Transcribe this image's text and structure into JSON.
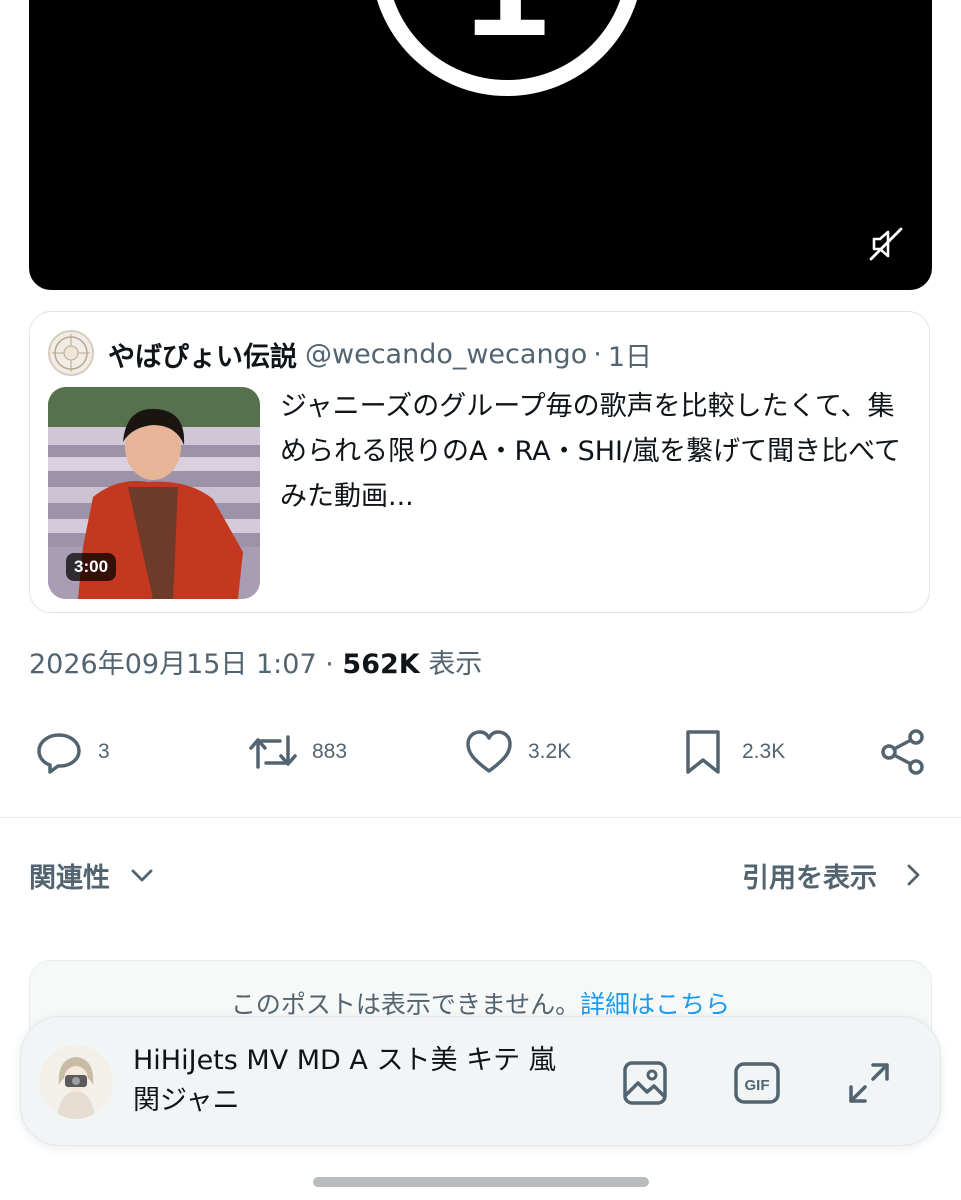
{
  "video": {
    "countdown_number": "1",
    "mute_icon": "speaker-muted-icon"
  },
  "quote": {
    "name": "やばぴょい伝説",
    "handle": "@wecando_wecango",
    "separator": "·",
    "time": "1日",
    "text": "ジャニーズのグループ毎の歌声を比較したくて、集められる限りのA・RA・SHI/嵐を繋げて聞き比べてみた動画...",
    "video_duration": "3:00"
  },
  "meta": {
    "timestamp": "2026年09月15日 1:07",
    "separator": "·",
    "views_count": "562K",
    "views_label": "表示"
  },
  "actions": {
    "replies": "3",
    "reposts": "883",
    "likes": "3.2K",
    "bookmarks": "2.3K"
  },
  "sort": {
    "label": "関連性"
  },
  "view_quotes": {
    "label": "引用を表示"
  },
  "unavailable": {
    "message": "このポストは表示できません。",
    "link": "詳細はこちら"
  },
  "composer": {
    "text": "HiHiJets MV MD A スト美 キテ 嵐 関ジャニ",
    "icons": [
      "image-icon",
      "gif-icon",
      "expand-icon"
    ]
  },
  "colors": {
    "text_primary": "#0f1419",
    "text_secondary": "#536471",
    "link": "#1d9bf0",
    "border": "#dfe4e8"
  }
}
